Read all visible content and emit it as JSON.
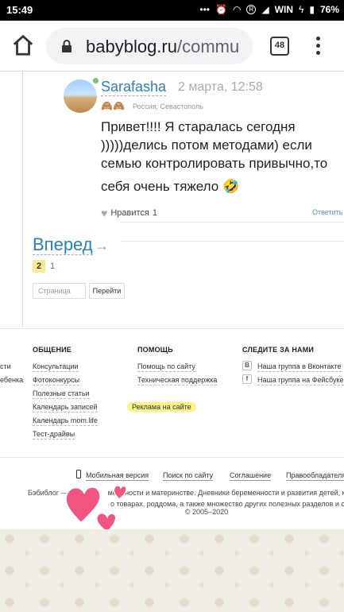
{
  "status_bar": {
    "time": "15:49",
    "carrier": "WIN",
    "battery": "76%"
  },
  "browser": {
    "url_host": "babyblog.ru",
    "url_path": "/commu",
    "tab_count": "48"
  },
  "post": {
    "username": "Sarafasha",
    "date": "2 марта, 12:58",
    "location": "Россия, Севастополь",
    "message_lines": [
      "Привет!!!! Я старалась сегодня",
      ")))))делись потом методами) если",
      "семью контролировать привычно,то",
      "себя очень тяжело 🤣"
    ],
    "like_label": "Нравится",
    "like_count": "1",
    "reply_label": "Ответить"
  },
  "pagination": {
    "forward_label": "Вперед",
    "arrow": "→",
    "pages": [
      "2",
      "1"
    ],
    "page_placeholder": "Страница",
    "go_label": "Перейти"
  },
  "footer": {
    "cut_left": [
      "сти",
      "ебенка"
    ],
    "col_general": {
      "title": "ОБЩЕНИЕ",
      "links": [
        "Консультации",
        "Фотоконкурсы",
        "Полезные статьи",
        "Календарь записей",
        "Календарь mom.life",
        "Тест-драйвы"
      ]
    },
    "col_help": {
      "title": "ПОМОЩЬ",
      "links": [
        "Помощь по сайту",
        "Техническая поддержка",
        "Реклама на сайте"
      ]
    },
    "col_follow": {
      "title": "СЛЕДИТЕ ЗА НАМИ",
      "links": [
        "Наша группа в Вконтакте",
        "Наша группа на Фейсбуке"
      ],
      "icons": [
        "В",
        "f"
      ]
    },
    "bottom_links": [
      "Мобильная версия",
      "Поиск по сайту",
      "Соглашение",
      "Правообладателям"
    ],
    "desc_line1_start": "Бэбиблог —",
    "desc_line1_end": "мемтности и материнстве. Дневники беременности и развития детей, клиники",
    "desc_line2": "о товарах, роддома, а также множество других полезных разделов и серви",
    "copyright": "© 2005–2020"
  },
  "colors": {
    "link": "#2b7fb5",
    "highlight": "#fbf28a",
    "heart": "#f2557f"
  }
}
